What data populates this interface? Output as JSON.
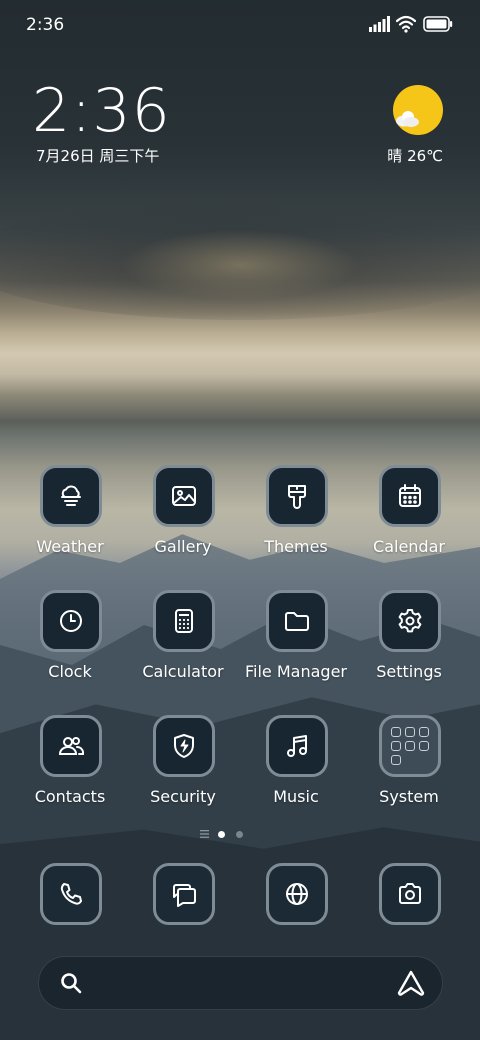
{
  "status_bar": {
    "time": "2:36"
  },
  "clock_widget": {
    "time": "2:36",
    "date": "7月26日 周三下午"
  },
  "weather_widget": {
    "text": "晴 26℃",
    "sun_color": "#f5c518"
  },
  "apps": [
    {
      "label": "Weather",
      "icon": "cloud-fog-icon"
    },
    {
      "label": "Gallery",
      "icon": "image-icon"
    },
    {
      "label": "Themes",
      "icon": "brush-icon"
    },
    {
      "label": "Calendar",
      "icon": "calendar-icon"
    },
    {
      "label": "Clock",
      "icon": "clock-icon"
    },
    {
      "label": "Calculator",
      "icon": "calculator-icon"
    },
    {
      "label": "File Manager",
      "icon": "folder-icon"
    },
    {
      "label": "Settings",
      "icon": "gear-icon"
    },
    {
      "label": "Contacts",
      "icon": "people-icon"
    },
    {
      "label": "Security",
      "icon": "shield-bolt-icon"
    },
    {
      "label": "Music",
      "icon": "music-note-icon"
    },
    {
      "label": "System",
      "icon": "folder-grid-icon"
    }
  ],
  "page_indicator": {
    "pages": 2,
    "current": 1
  },
  "dock": [
    {
      "name": "phone",
      "icon": "phone-icon"
    },
    {
      "name": "messages",
      "icon": "message-icon"
    },
    {
      "name": "browser",
      "icon": "globe-icon"
    },
    {
      "name": "camera",
      "icon": "camera-icon"
    }
  ],
  "search_bar": {
    "left_icon": "search-icon",
    "right_icon": "assistant-icon"
  },
  "colors": {
    "tile_bg": "#172631",
    "tile_border": "#7f8c95",
    "icon": "#ffffff"
  }
}
